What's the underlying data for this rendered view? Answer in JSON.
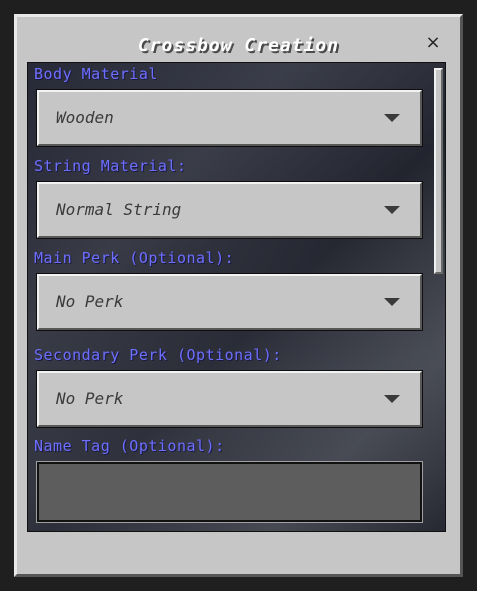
{
  "dialog": {
    "title": "Crossbow Creation",
    "close_icon": "close-icon",
    "close_glyph": "×"
  },
  "fields": {
    "body_material": {
      "label": "Body Material",
      "value": "Wooden"
    },
    "string_material": {
      "label": "String Material:",
      "value": "Normal String"
    },
    "main_perk": {
      "label": "Main Perk (Optional):",
      "value": "No Perk"
    },
    "secondary_perk": {
      "label": "Secondary Perk (Optional):",
      "value": "No Perk"
    },
    "name_tag": {
      "label": "Name Tag (Optional):",
      "value": ""
    }
  },
  "colors": {
    "label": "#6e6eff",
    "panel": "#c6c6c6",
    "textfield": "#5d5d5d"
  }
}
